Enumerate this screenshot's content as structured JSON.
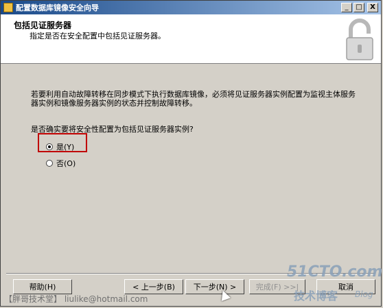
{
  "window": {
    "title": "配置数据库镜像安全向导"
  },
  "titlebar_buttons": {
    "minimize": "_",
    "maximize": "□",
    "close": "X"
  },
  "header": {
    "title": "包括见证服务器",
    "subtitle": "指定是否在安全配置中包括见证服务器。"
  },
  "content": {
    "paragraph": "若要利用自动故障转移在同步模式下执行数据库镜像，必须将见证服务器实例配置为监视主体服务器实例和镜像服务器实例的状态并控制故障转移。",
    "question": "是否确实要将安全性配置为包括见证服务器实例?",
    "options": [
      {
        "label": "是(Y)",
        "selected": true
      },
      {
        "label": "否(O)",
        "selected": false
      }
    ]
  },
  "buttons": {
    "help": "帮助(H)",
    "back": "< 上一步(B)",
    "next": "下一步(N) >",
    "finish": "完成(F) >>|",
    "cancel": "取消"
  },
  "watermark": {
    "left": "【胖哥技术堂】 liulike@hotmail.com",
    "logo": "51CTO.com",
    "blog_cn": "技术博客",
    "blog_en": "Blog"
  }
}
